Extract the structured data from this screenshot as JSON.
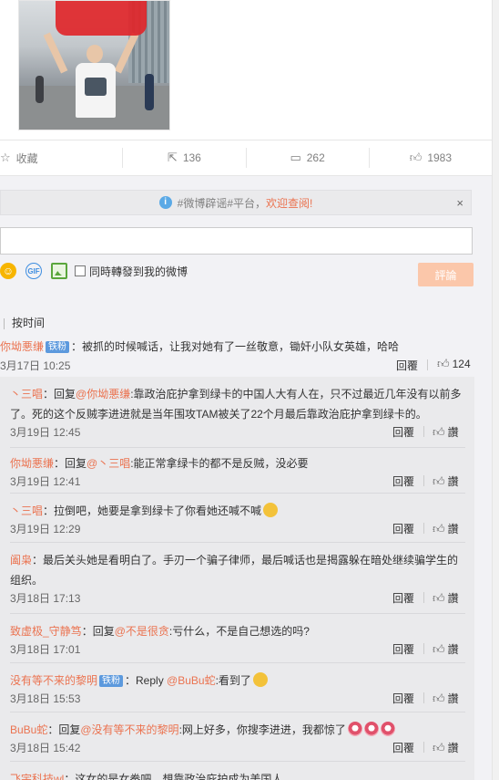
{
  "post": {
    "actions": [
      {
        "name": "favorite",
        "icon": "star-icon",
        "label": "收藏"
      },
      {
        "name": "repost",
        "icon": "share-icon",
        "label": "136"
      },
      {
        "name": "comment",
        "icon": "comment-icon",
        "label": "262"
      },
      {
        "name": "like",
        "icon": "thumbs-up-icon",
        "label": "1983"
      }
    ]
  },
  "notice": {
    "text": "#微博辟谣#平台，",
    "link": "欢迎查阅!",
    "close": "×"
  },
  "composer": {
    "placeholder": "",
    "tools": [
      "emoji-icon",
      "gif-icon",
      "image-icon"
    ],
    "gif_label": "GIF",
    "sync_label": "同時轉發到我的微博",
    "submit_label": "評論"
  },
  "sort": {
    "label": "按时间"
  },
  "top_comment": {
    "user": "你坳悪缣",
    "badge": "铁粉",
    "text": "：被抓的时候喊话，让我对她有了一丝敬意，锄奸小队女英雄，哈哈",
    "date": "3月17日 10:25",
    "reply_label": "回覆",
    "likes": "124"
  },
  "replies": [
    {
      "user": "丶三唱",
      "prefix": "：回复",
      "mention": "@你坳悪缣",
      "text": ":靠政治庇护拿到绿卡的中国人大有人在，只不过最近几年没有以前多了。死的这个反贼李进进就是当年围攻TAM被关了22个月最后靠政治庇护拿到绿卡的。",
      "date": "3月19日 12:45",
      "reply_label": "回覆",
      "like_label": "讚"
    },
    {
      "user": "你坳悪缣",
      "prefix": "：回复",
      "mention": "@丶三唱",
      "text": ":能正常拿绿卡的都不是反贼，没必要",
      "date": "3月19日 12:41",
      "reply_label": "回覆",
      "like_label": "讚"
    },
    {
      "user": "丶三唱",
      "prefix": "",
      "mention": "",
      "text": "：拉倒吧，她要是拿到绿卡了你看她还喊不喊",
      "date": "3月19日 12:29",
      "reply_label": "回覆",
      "like_label": "讚"
    },
    {
      "user": "阖枭",
      "prefix": "",
      "mention": "",
      "text": "：最后关头她是看明白了。手刃一个骗子律师，最后喊话也是揭露躲在暗处继续骗学生的组织。",
      "date": "3月18日 17:13",
      "reply_label": "回覆",
      "like_label": "讚"
    },
    {
      "user": "致虚极_守静笃",
      "prefix": "：回复",
      "mention": "@不是很贪",
      "text": ":亏什么，不是自己想选的吗?",
      "date": "3月18日 17:01",
      "reply_label": "回覆",
      "like_label": "讚"
    },
    {
      "user": "没有等不来的黎明",
      "badge": "铁粉",
      "prefix": "：Reply ",
      "mention": "@BuBu蛇",
      "text": ":看到了",
      "date": "3月18日 15:53",
      "reply_label": "回覆",
      "like_label": "讚"
    },
    {
      "user": "BuBu蛇",
      "prefix": "：回复",
      "mention": "@没有等不来的黎明",
      "text": ":网上好多，你搜李进进，我都惊了",
      "date": "3月18日 15:42",
      "reply_label": "回覆",
      "like_label": "讚"
    },
    {
      "user": "飞宇科技wl",
      "prefix": "",
      "mention": "",
      "text": "：这女的是女拳吧，想靠政治庇护成为美国人",
      "date": "",
      "reply_label": "",
      "like_label": ""
    }
  ]
}
